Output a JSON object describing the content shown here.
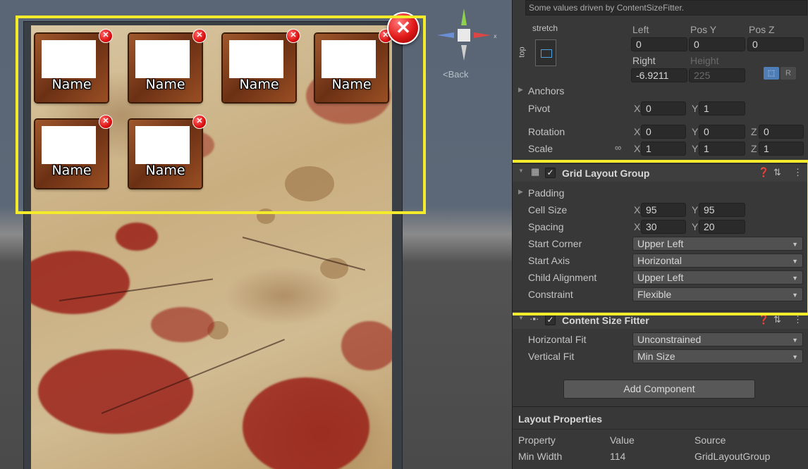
{
  "scene": {
    "back_label": "Back",
    "slots": [
      {
        "name": "Name"
      },
      {
        "name": "Name"
      },
      {
        "name": "Name"
      },
      {
        "name": "Name"
      },
      {
        "name": "Name"
      },
      {
        "name": "Name"
      }
    ]
  },
  "inspector": {
    "note": "Some values driven by ContentSizeFitter.",
    "anchor_preset": "stretch",
    "anchor_side": "top",
    "rect": {
      "left_label": "Left",
      "left_value": "0",
      "posy_label": "Pos Y",
      "posy_value": "0",
      "posz_label": "Pos Z",
      "posz_value": "0",
      "right_label": "Right",
      "right_value": "-6.9211",
      "height_label": "Height",
      "height_value": "225"
    },
    "anchors_label": "Anchors",
    "pivot": {
      "label": "Pivot",
      "x": "0",
      "y": "1"
    },
    "rotation": {
      "label": "Rotation",
      "x": "0",
      "y": "0",
      "z": "0"
    },
    "scale": {
      "label": "Scale",
      "x": "1",
      "y": "1",
      "z": "1"
    },
    "axis": {
      "x": "X",
      "y": "Y",
      "z": "Z"
    },
    "grid_layout": {
      "title": "Grid Layout Group",
      "enabled": true,
      "padding_label": "Padding",
      "cell_size": {
        "label": "Cell Size",
        "x": "95",
        "y": "95"
      },
      "spacing": {
        "label": "Spacing",
        "x": "30",
        "y": "20"
      },
      "start_corner": {
        "label": "Start Corner",
        "value": "Upper Left"
      },
      "start_axis": {
        "label": "Start Axis",
        "value": "Horizontal"
      },
      "child_alignment": {
        "label": "Child Alignment",
        "value": "Upper Left"
      },
      "constraint": {
        "label": "Constraint",
        "value": "Flexible"
      }
    },
    "content_size_fitter": {
      "title": "Content Size Fitter",
      "enabled": true,
      "horizontal_fit": {
        "label": "Horizontal Fit",
        "value": "Unconstrained"
      },
      "vertical_fit": {
        "label": "Vertical Fit",
        "value": "Min Size"
      }
    },
    "add_component": "Add Component",
    "layout_properties": {
      "title": "Layout Properties",
      "columns": [
        "Property",
        "Value",
        "Source"
      ],
      "rows": [
        {
          "property": "Min Width",
          "value": "114",
          "source": "GridLayoutGroup"
        }
      ]
    }
  },
  "colors": {
    "highlight": "#f4eb2a",
    "close_red": "#e01818",
    "inspector_bg": "#383838"
  }
}
